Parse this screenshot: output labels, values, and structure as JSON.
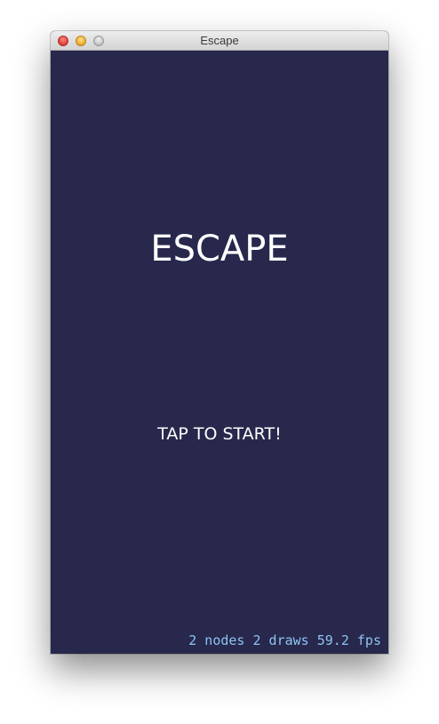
{
  "window": {
    "title": "Escape",
    "buttons": {
      "close_icon": "close-icon",
      "minimize_icon": "minimize-icon",
      "zoom_icon": "zoom-icon"
    }
  },
  "scene": {
    "title": "ESCAPE",
    "prompt": "TAP TO START!",
    "stats": "2 nodes 2 draws 59.2 fps",
    "background_color": "#27284c",
    "stats_color": "#8fc3f2"
  }
}
